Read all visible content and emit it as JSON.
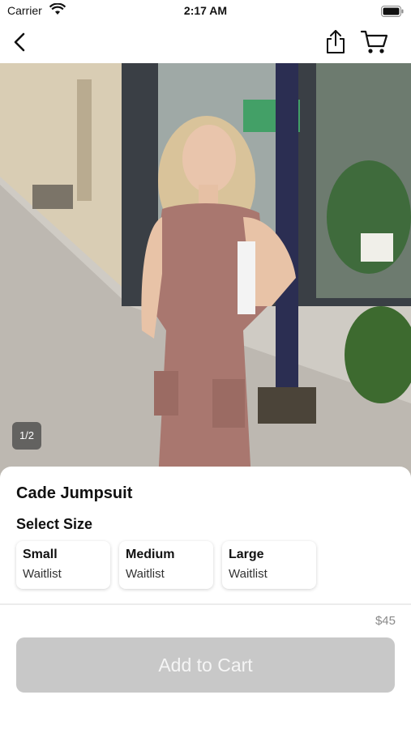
{
  "status_bar": {
    "carrier": "Carrier",
    "time": "2:17 AM"
  },
  "nav": {
    "back_icon": "chevron-left-icon",
    "share_icon": "share-icon",
    "cart_icon": "cart-icon"
  },
  "gallery": {
    "counter": "1/2"
  },
  "product": {
    "title": "Cade Jumpsuit",
    "select_size_label": "Select Size",
    "sizes": [
      {
        "name": "Small",
        "status": "Waitlist"
      },
      {
        "name": "Medium",
        "status": "Waitlist"
      },
      {
        "name": "Large",
        "status": "Waitlist"
      }
    ],
    "price": "$45",
    "add_to_cart_label": "Add to Cart"
  },
  "colors": {
    "button_disabled": "#c8c8c8",
    "jumpsuit": "#a9776f"
  }
}
